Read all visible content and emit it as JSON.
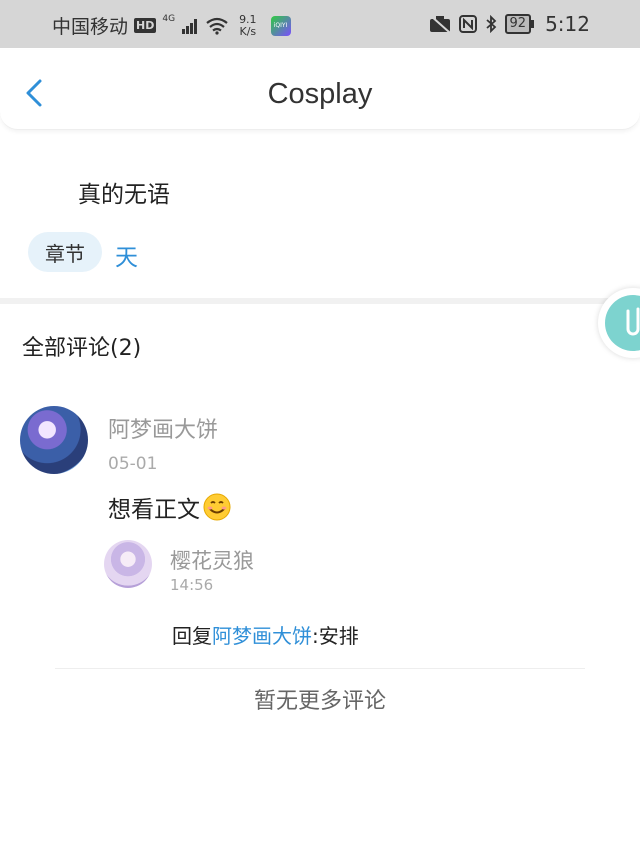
{
  "status_bar": {
    "carrier": "中国移动",
    "hd": "HD",
    "network": "4G",
    "speed_value": "9.1",
    "speed_unit": "K/s",
    "app_badge": "iQIYI",
    "battery": "92",
    "time": "5:12"
  },
  "nav": {
    "title": "Cosplay",
    "back_icon": "chevron-left-icon"
  },
  "post": {
    "text": "真的无语",
    "tag_label": "章节",
    "chapter": "天"
  },
  "comments": {
    "header": "全部评论(2)",
    "items": [
      {
        "username": "阿梦画大饼",
        "date": "05-01",
        "text": "想看正文",
        "emoji": "smiling-face-icon",
        "replies": [
          {
            "username": "樱花灵狼",
            "time": "14:56",
            "prefix": "回复",
            "mention": "阿梦画大饼",
            "colon_text": ":安排"
          }
        ]
      }
    ],
    "footer": "暂无更多评论"
  },
  "colors": {
    "accent": "#2f8fd8",
    "tag_bg": "#e6f2fa",
    "float_button": "#7dd3cf"
  }
}
